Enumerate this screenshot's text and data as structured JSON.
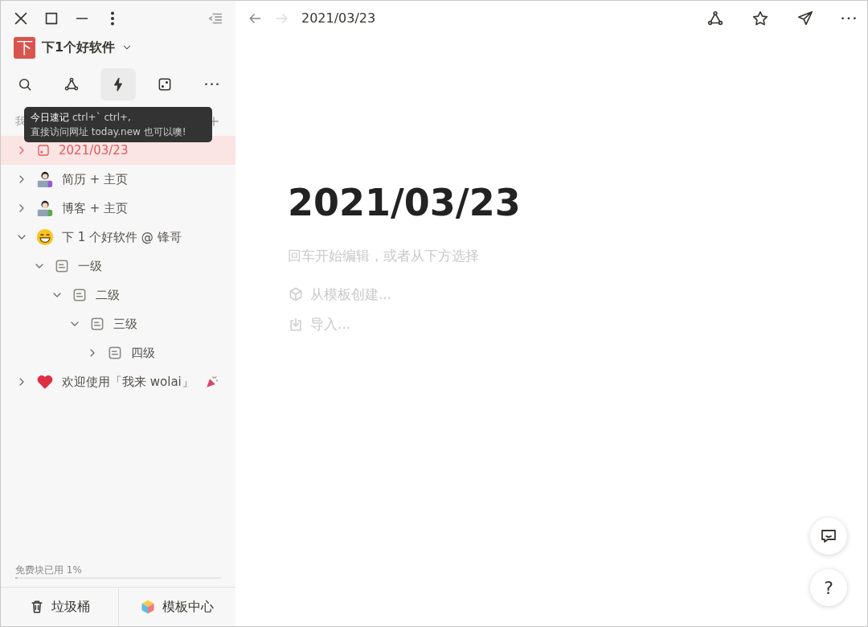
{
  "workspace": {
    "name": "下1个好软件",
    "logo": "下"
  },
  "toolbar": [
    {
      "kind": "search",
      "selected": false
    },
    {
      "kind": "graph",
      "selected": false
    },
    {
      "kind": "lightning",
      "selected": true
    },
    {
      "kind": "dice",
      "selected": false
    },
    {
      "kind": "more",
      "selected": false
    }
  ],
  "tooltip": {
    "title": "今日速记",
    "shortcut": "ctrl+` ctrl+,",
    "hint": "直接访问网址 today.new 也可以噢!"
  },
  "section": {
    "label": "我"
  },
  "tree": [
    {
      "label": "2021/03/23",
      "kind": "date",
      "expanded": false,
      "selected": true
    },
    {
      "label": "简历 + 主页",
      "kind": "avatar-woman",
      "expanded": false,
      "selected": false
    },
    {
      "label": "博客 + 主页",
      "kind": "avatar-man",
      "expanded": false,
      "selected": false
    },
    {
      "label": "下 1 个好软件 @ 锋哥",
      "kind": "smiley",
      "expanded": true,
      "selected": false,
      "children": [
        {
          "label": "一级",
          "kind": "page",
          "expanded": true,
          "selected": false,
          "children": [
            {
              "label": "二级",
              "kind": "page",
              "expanded": true,
              "selected": false,
              "children": [
                {
                  "label": "三级",
                  "kind": "page",
                  "expanded": true,
                  "selected": false,
                  "children": [
                    {
                      "label": "四级",
                      "kind": "page",
                      "expanded": false,
                      "selected": false
                    }
                  ]
                }
              ]
            }
          ]
        }
      ]
    },
    {
      "label": "欢迎使用「我来 wolai」",
      "kind": "heart",
      "party_icon": true,
      "expanded": false,
      "selected": false
    }
  ],
  "usage": {
    "label": "免费块已用 1%",
    "level": 0.01
  },
  "footer": [
    {
      "kind": "trash",
      "label": "垃圾桶"
    },
    {
      "kind": "templates",
      "label": "模板中心"
    }
  ],
  "topbar": {
    "back_enabled": true,
    "forward_enabled": false,
    "breadcrumb": "2021/03/23"
  },
  "page": {
    "title": "2021/03/23",
    "placeholder": "回车开始编辑，或者从下方选择",
    "options": [
      {
        "kind": "template",
        "label": "从模板创建..."
      },
      {
        "kind": "import",
        "label": "导入..."
      }
    ]
  },
  "floating": [
    {
      "kind": "chat"
    },
    {
      "kind": "help",
      "label": "?"
    }
  ]
}
